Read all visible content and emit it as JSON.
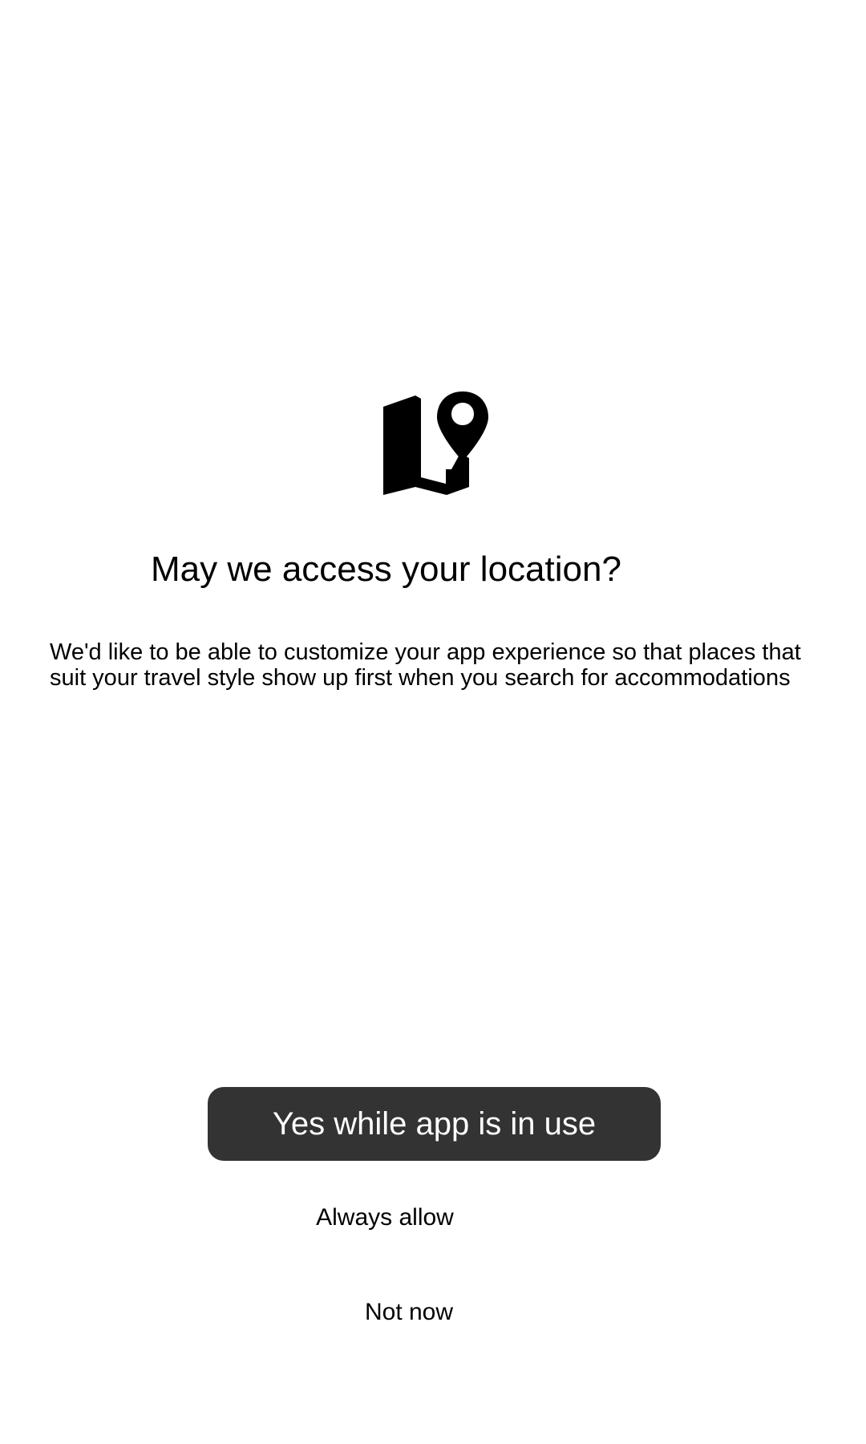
{
  "permission_prompt": {
    "icon": "map-location-icon",
    "title": "May we access your location?",
    "description": "We'd like to be able to customize your app experience so that places that suit your travel style show up first when you search for accommodations",
    "primary_action": "Yes while app is in use",
    "secondary_action": "Always allow",
    "dismiss_action": "Not now"
  },
  "colors": {
    "background": "#ffffff",
    "text": "#000000",
    "primary_button": "#333333",
    "primary_button_text": "#ffffff"
  }
}
